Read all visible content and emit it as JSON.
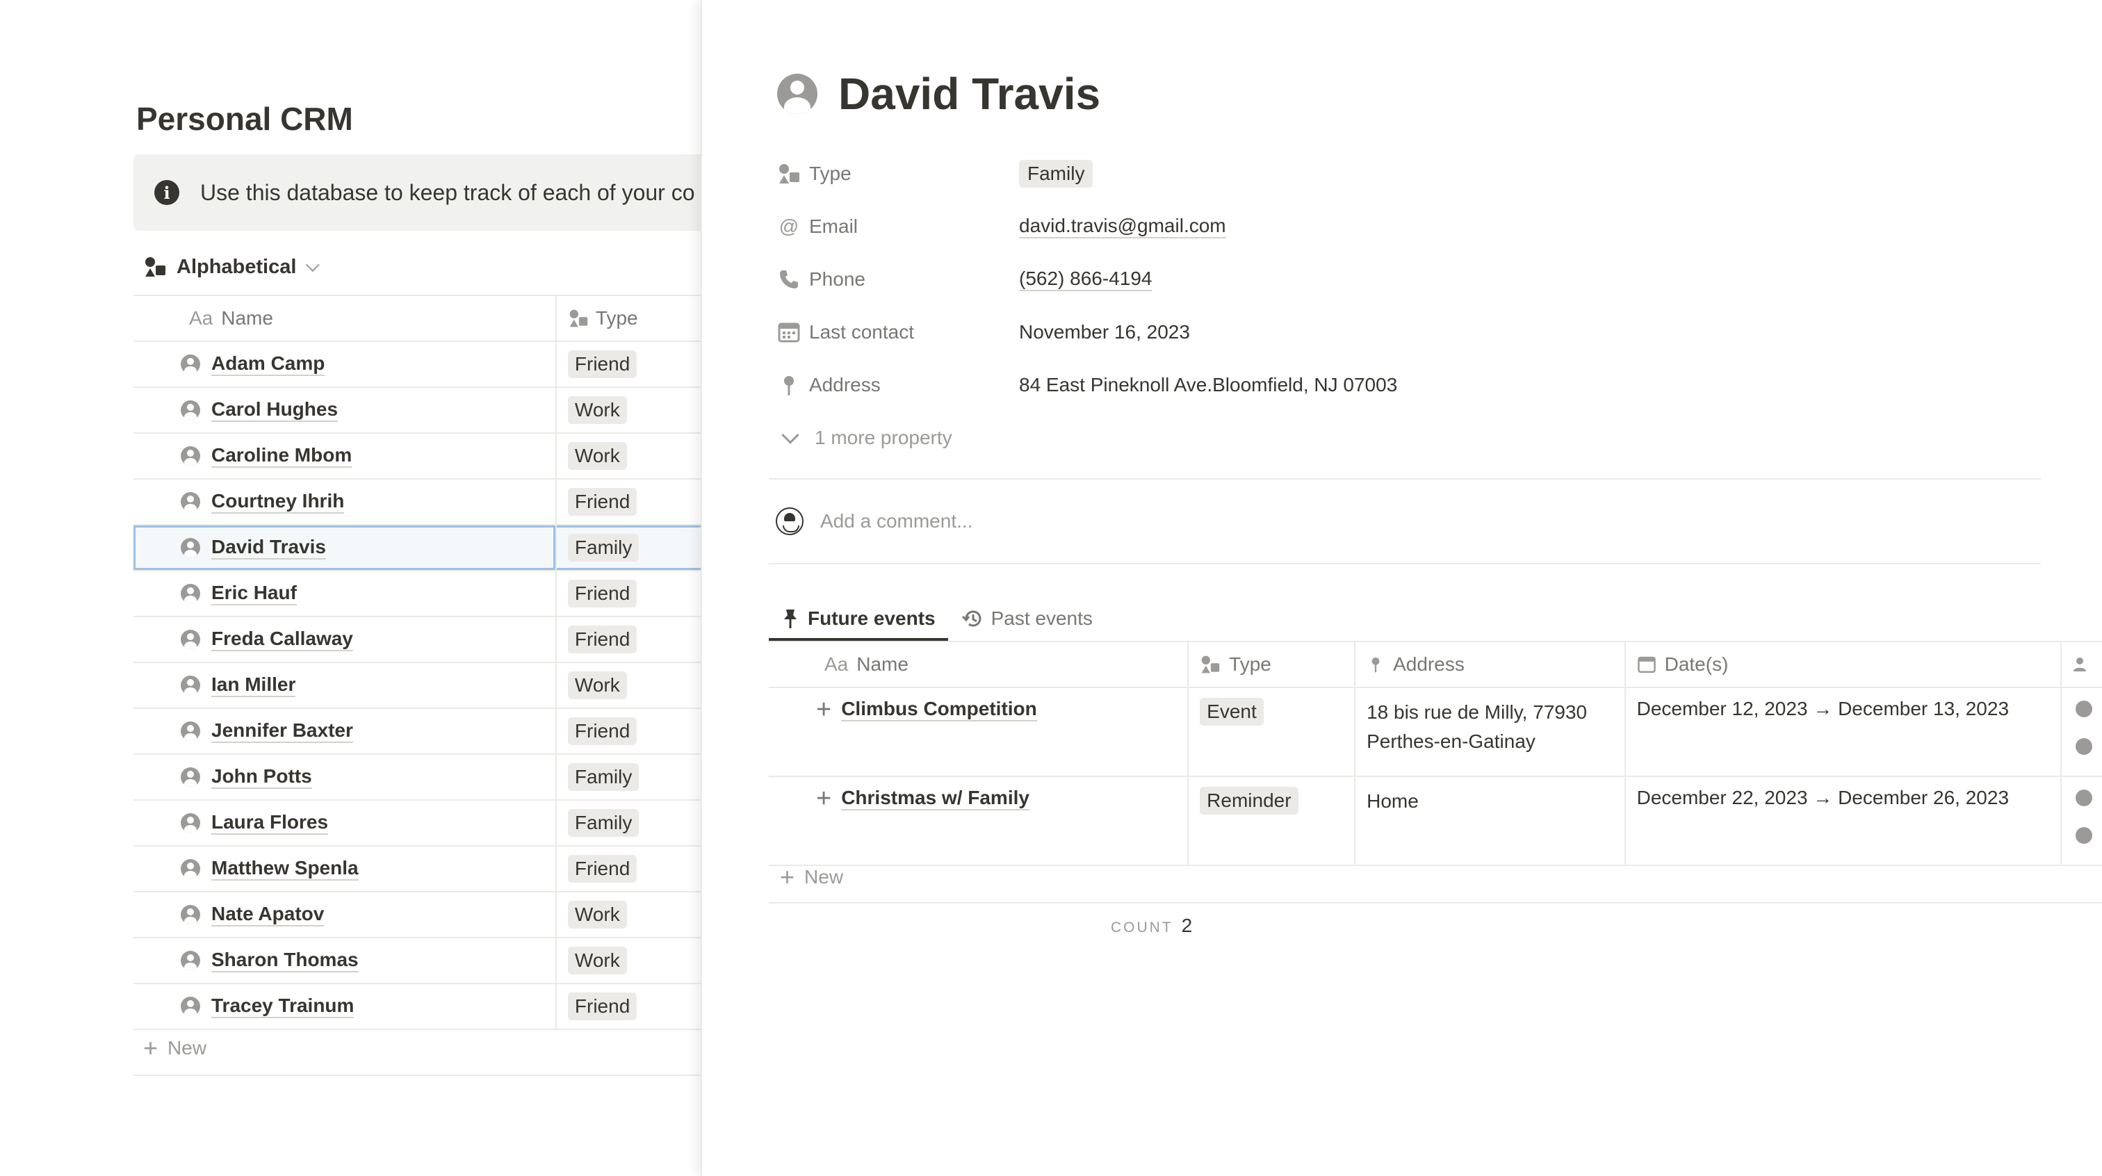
{
  "left": {
    "page_title": "Personal CRM",
    "callout_text": "Use this database to keep track of each of your co",
    "view_label": "Alphabetical",
    "columns": {
      "name": "Name",
      "type": "Type",
      "aa": "Aa"
    },
    "rows": [
      {
        "name": "Adam Camp",
        "type": "Friend"
      },
      {
        "name": "Carol Hughes",
        "type": "Work"
      },
      {
        "name": "Caroline Mbom",
        "type": "Work"
      },
      {
        "name": "Courtney Ihrih",
        "type": "Friend"
      },
      {
        "name": "David Travis",
        "type": "Family",
        "selected": true
      },
      {
        "name": "Eric Hauf",
        "type": "Friend"
      },
      {
        "name": "Freda Callaway",
        "type": "Friend"
      },
      {
        "name": "Ian Miller",
        "type": "Work"
      },
      {
        "name": "Jennifer Baxter",
        "type": "Friend"
      },
      {
        "name": "John Potts",
        "type": "Family"
      },
      {
        "name": "Laura Flores",
        "type": "Family"
      },
      {
        "name": "Matthew Spenla",
        "type": "Friend"
      },
      {
        "name": "Nate Apatov",
        "type": "Work"
      },
      {
        "name": "Sharon Thomas",
        "type": "Work"
      },
      {
        "name": "Tracey Trainum",
        "type": "Friend"
      }
    ],
    "new_label": "New"
  },
  "peek": {
    "title": "David Travis",
    "properties": {
      "type_label": "Type",
      "type_value": "Family",
      "email_label": "Email",
      "email_value": "david.travis@gmail.com",
      "phone_label": "Phone",
      "phone_value": "(562) 866-4194",
      "last_contact_label": "Last contact",
      "last_contact_value": "November 16, 2023",
      "address_label": "Address",
      "address_value": "84 East Pineknoll Ave.Bloomfield, NJ 07003",
      "more_label": "1 more property"
    },
    "comment_placeholder": "Add a comment...",
    "tabs": {
      "future": "Future events",
      "past": "Past events"
    },
    "event_columns": {
      "aa": "Aa",
      "name": "Name",
      "type": "Type",
      "address": "Address",
      "dates": "Date(s)"
    },
    "events": [
      {
        "name": "Climbus Competition",
        "type": "Event",
        "address": "18 bis rue de Milly, 77930 Perthes-en-Gatinay",
        "dates": "December 12, 2023 → December 13, 2023"
      },
      {
        "name": "Christmas w/ Family",
        "type": "Reminder",
        "address": "Home",
        "dates": "December 22, 2023 → December 26, 2023"
      }
    ],
    "new_label": "New",
    "count_label": "COUNT",
    "count_value": "2"
  }
}
